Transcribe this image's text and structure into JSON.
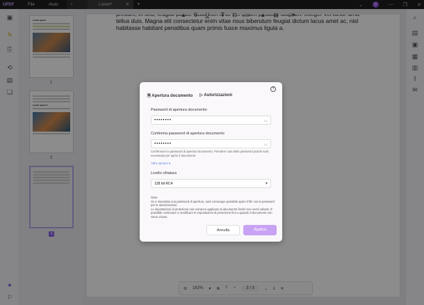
{
  "titlebar": {
    "logo": "UPDF",
    "menu": [
      "File",
      "Aiuto"
    ],
    "tab_title": "Lorem*",
    "avatar": "D"
  },
  "thumbnails": [
    {
      "label": "1",
      "heading": "Lorem ipsum"
    },
    {
      "label": "2",
      "heading": "Lorem ipsum 2"
    },
    {
      "label": "3"
    }
  ],
  "document": {
    "text": "pretium, in sed, feugiat purus. Nulla non ante vel ipsum posuere aliquam. Integer vel tortor urna tellus duis. Magna elit consectetur enim vitae risus bibendum feugiat dictum lacus amet ac, nisl habitasse habitant penatibus quam primis fusce maximus ligula a."
  },
  "bottombar": {
    "zoom": "162%",
    "page": "3",
    "total": "3"
  },
  "dialog": {
    "tab_open": "Apertura documento",
    "tab_perm": "Autorizzazioni",
    "pwd_label": "Password di apertura documento",
    "pwd_value": "••••••••",
    "confirm_label": "Conferma password di apertura documento",
    "confirm_value": "••••••••",
    "hint": "Confermare la password di apertura documento. Prendere nota della password poiché sarà necessaria per aprire il documento.",
    "more": "Altre opzioni ▾",
    "enc_label": "Livello cifratura",
    "enc_value": "128 bit RC4",
    "note": "Nota:\nSe è impostata una password di apertura, sarà comunque possibile aprire il file con la password per le autorizzazioni.\nLe impostazioni di protezione non verranno applicate al documento finché non verrà salvato. È possibile continuare a modificare le impostazioni di protezione fino a quando il documento non viene chiuso.",
    "cancel": "Annulla",
    "apply": "Applica"
  }
}
